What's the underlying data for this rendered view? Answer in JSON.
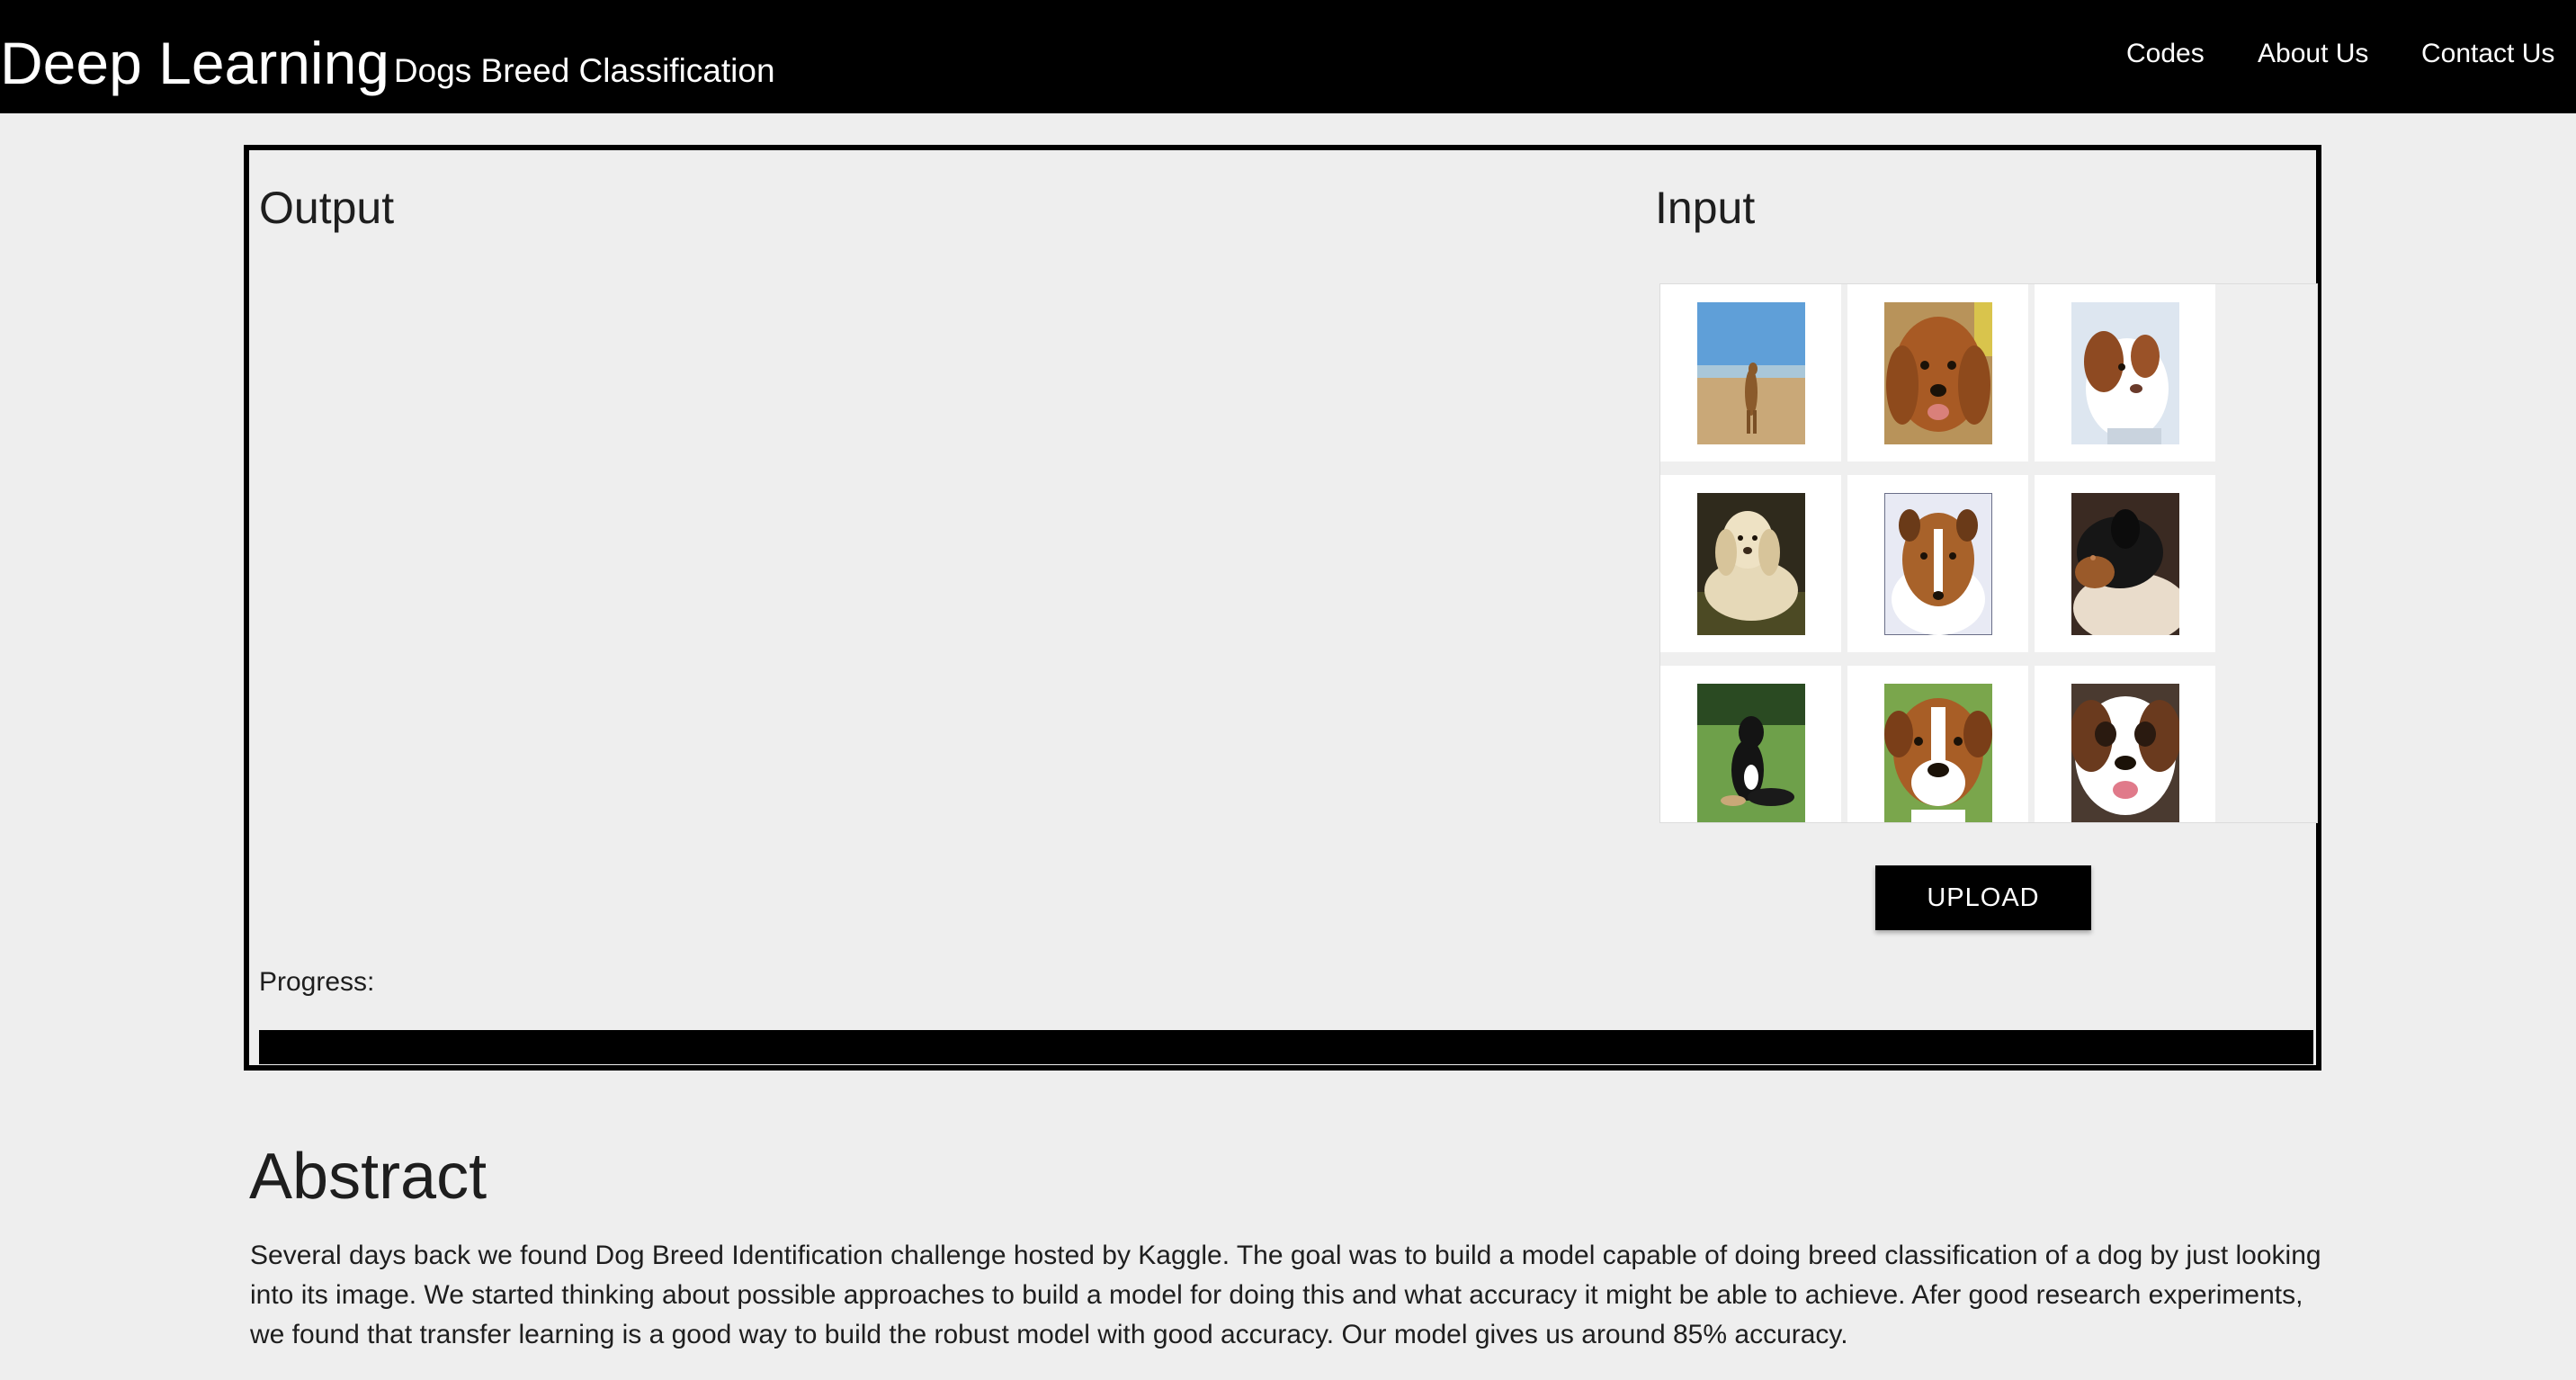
{
  "header": {
    "title": "Deep Learning",
    "subtitle": "| Dogs Breed Classification",
    "nav": [
      "Codes",
      "About Us",
      "Contact Us"
    ]
  },
  "main": {
    "output_heading": "Output",
    "input_heading": "Input",
    "upload_label": "UPLOAD",
    "progress_label": "Progress:",
    "progress_value": 1.0,
    "gallery": [
      "dog-on-beach-thumbnail",
      "golden-retriever-thumbnail",
      "brittany-spaniel-thumbnail",
      "cocker-spaniel-thumbnail",
      "collie-thumbnail",
      "black-and-tan-hound-thumbnail",
      "black-dog-on-grass-thumbnail",
      "boxer-thumbnail",
      "saint-bernard-thumbnail"
    ]
  },
  "abstract": {
    "title": "Abstract",
    "body": "Several days back we found Dog Breed Identification challenge hosted by Kaggle. The goal was to build a model capable of doing breed classification of a dog by just looking into its image. We started thinking about possible approaches to build a model for doing this and what accuracy it might be able to achieve. Afer good research experiments, we found that transfer learning is a good way to build the robust model with good accuracy. Our model gives us around 85% accuracy."
  }
}
